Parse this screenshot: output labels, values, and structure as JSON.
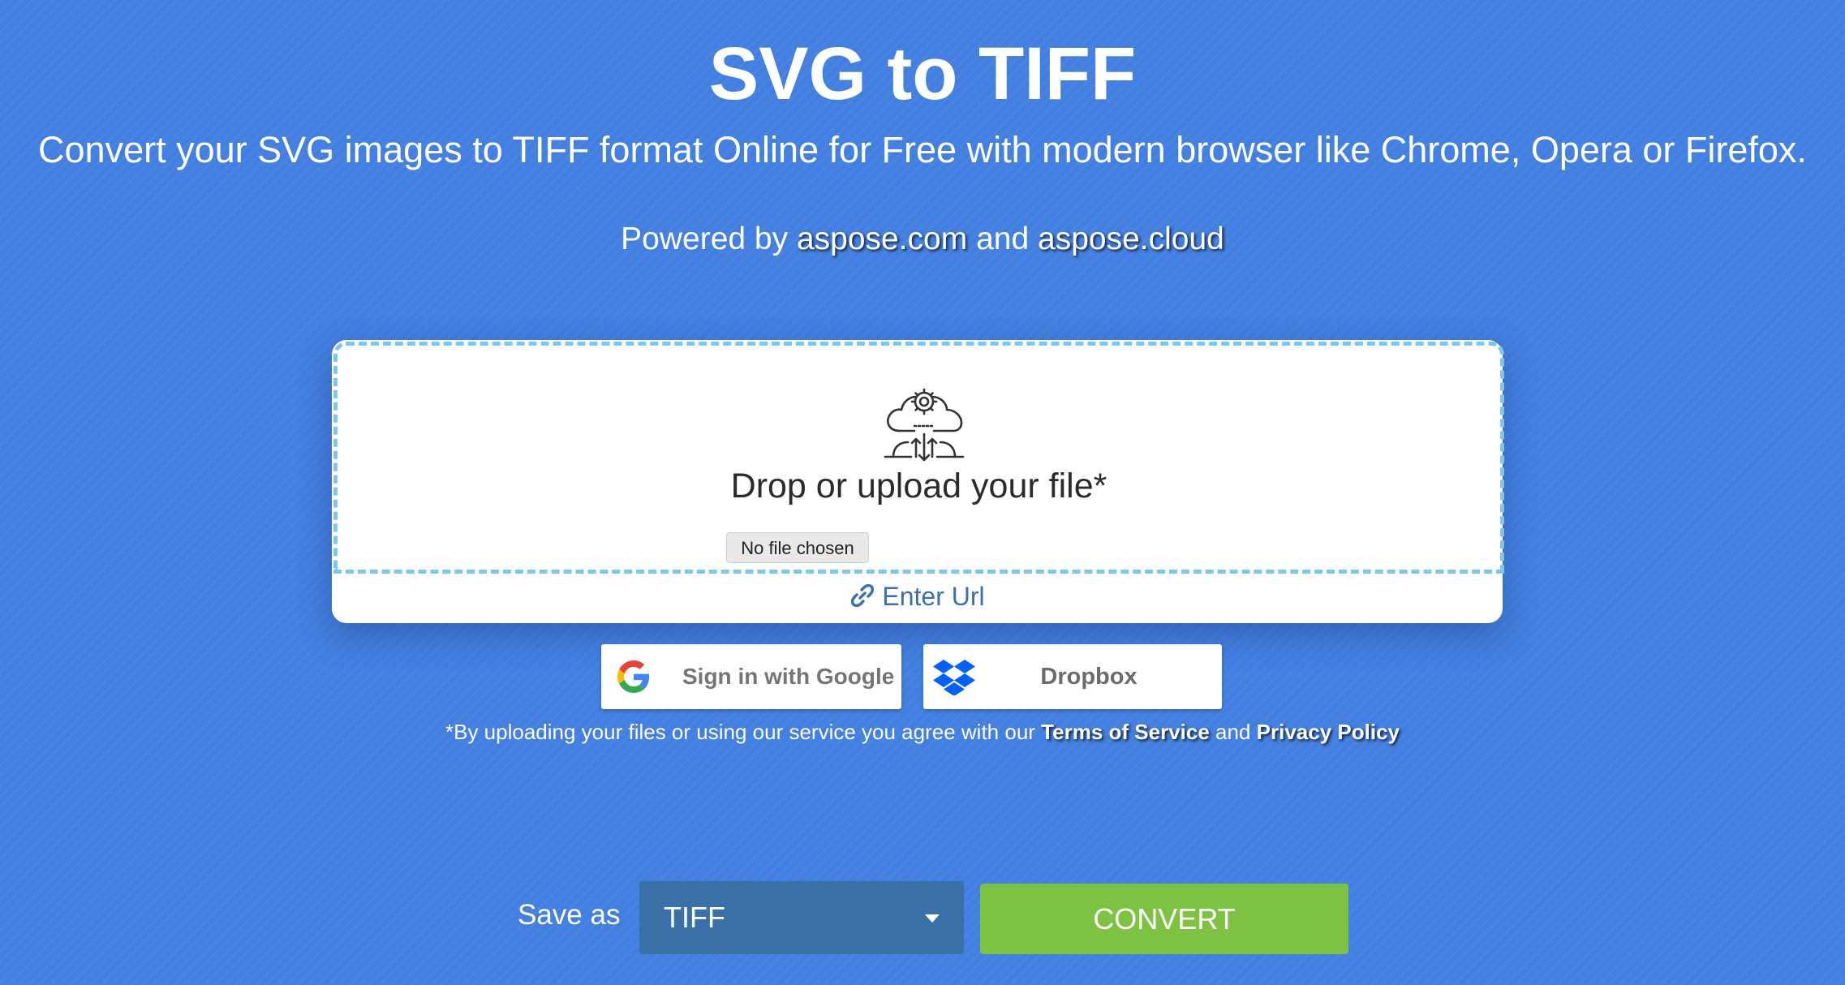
{
  "header": {
    "title": "SVG to TIFF",
    "subtitle": "Convert your SVG images to TIFF format Online for Free with modern browser like Chrome, Opera or Firefox.",
    "powered_prefix": "Powered by",
    "powered_link1": "aspose.com",
    "powered_and": "and",
    "powered_link2": "aspose.cloud"
  },
  "upload": {
    "icon": "cloud-gear-upload-icon",
    "drop_text": "Drop or upload your file*",
    "file_button": "No file chosen",
    "enter_url": "Enter Url",
    "enter_url_icon": "link-icon"
  },
  "providers": {
    "google_label": "Sign in with Google",
    "dropbox_label": "Dropbox"
  },
  "terms": {
    "prefix": "*By uploading your files or using our service you agree with our",
    "tos": "Terms of Service",
    "and": "and",
    "privacy": "Privacy Policy"
  },
  "convert_bar": {
    "save_as_label": "Save as",
    "format_selected": "TIFF",
    "convert_label": "CONVERT"
  },
  "colors": {
    "background": "#427fe0",
    "dashed_border": "#7dc6ec",
    "select_bg": "#3970a8",
    "convert_bg": "#7dc242",
    "link_blue": "#3a6fb5"
  }
}
